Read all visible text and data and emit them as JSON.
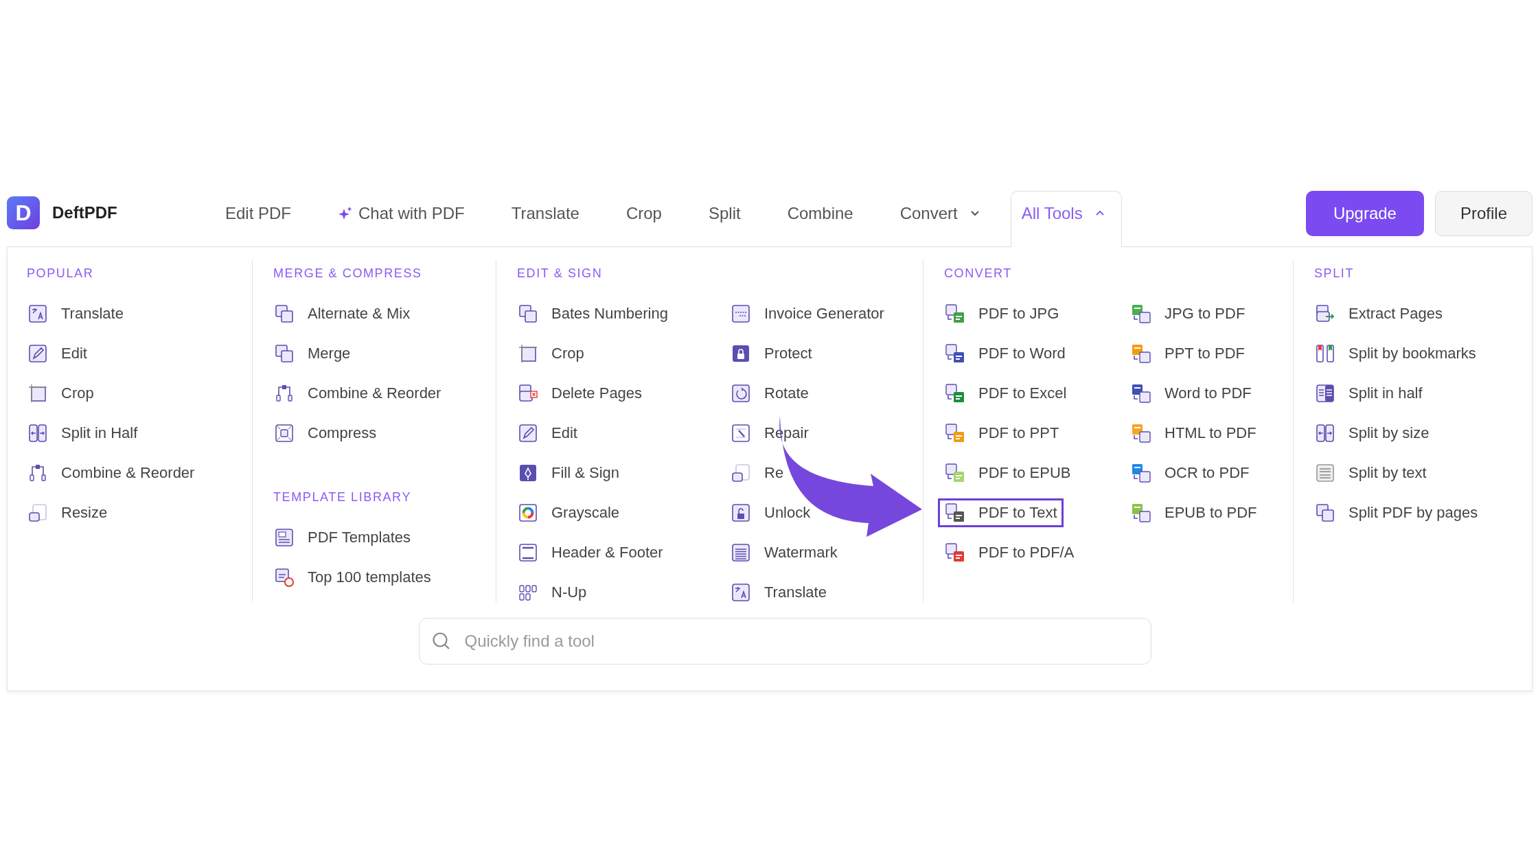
{
  "brand": {
    "mark": "D",
    "name": "DeftPDF"
  },
  "nav": [
    {
      "label": "Edit PDF",
      "kind": "link",
      "selected": false
    },
    {
      "label": "Chat with PDF",
      "kind": "ai",
      "selected": false
    },
    {
      "label": "Translate",
      "kind": "link",
      "selected": false
    },
    {
      "label": "Crop",
      "kind": "link",
      "selected": false
    },
    {
      "label": "Split",
      "kind": "link",
      "selected": false
    },
    {
      "label": "Combine",
      "kind": "link",
      "selected": false
    },
    {
      "label": "Convert",
      "kind": "dropdown",
      "selected": false,
      "expanded": false
    },
    {
      "label": "All Tools",
      "kind": "dropdown",
      "selected": true,
      "expanded": true
    }
  ],
  "actions": [
    {
      "label": "Upgrade",
      "kind": "primary"
    },
    {
      "label": "Profile",
      "kind": "secondary"
    }
  ],
  "menu": {
    "sections": [
      {
        "groups": [
          {
            "title": "POPULAR",
            "columns": [
              [
                {
                  "label": "Translate",
                  "highlighted": false
                },
                {
                  "label": "Edit",
                  "highlighted": false
                },
                {
                  "label": "Crop",
                  "highlighted": false
                },
                {
                  "label": "Split in Half",
                  "highlighted": false
                },
                {
                  "label": "Combine & Reorder",
                  "highlighted": false
                },
                {
                  "label": "Resize",
                  "highlighted": false
                }
              ]
            ]
          }
        ]
      },
      {
        "groups": [
          {
            "title": "MERGE & COMPRESS",
            "columns": [
              [
                {
                  "label": "Alternate & Mix",
                  "highlighted": false
                },
                {
                  "label": "Merge",
                  "highlighted": false
                },
                {
                  "label": "Combine & Reorder",
                  "highlighted": false
                },
                {
                  "label": "Compress",
                  "highlighted": false
                }
              ]
            ]
          },
          {
            "title": "TEMPLATE LIBRARY",
            "columns": [
              [
                {
                  "label": "PDF Templates",
                  "highlighted": false
                },
                {
                  "label": "Top 100 templates",
                  "highlighted": false
                }
              ]
            ]
          }
        ]
      },
      {
        "groups": [
          {
            "title": "EDIT & SIGN",
            "columns": [
              [
                {
                  "label": "Bates Numbering",
                  "highlighted": false
                },
                {
                  "label": "Crop",
                  "highlighted": false
                },
                {
                  "label": "Delete Pages",
                  "highlighted": false
                },
                {
                  "label": "Edit",
                  "highlighted": false
                },
                {
                  "label": "Fill & Sign",
                  "highlighted": false
                },
                {
                  "label": "Grayscale",
                  "highlighted": false
                },
                {
                  "label": "Header & Footer",
                  "highlighted": false
                },
                {
                  "label": "N-Up",
                  "highlighted": false
                }
              ],
              [
                {
                  "label": "Invoice Generator",
                  "highlighted": false
                },
                {
                  "label": "Protect",
                  "highlighted": false
                },
                {
                  "label": "Rotate",
                  "highlighted": false
                },
                {
                  "label": "Repair",
                  "highlighted": false
                },
                {
                  "label": "Re",
                  "highlighted": false
                },
                {
                  "label": "Unlock",
                  "highlighted": false
                },
                {
                  "label": "Watermark",
                  "highlighted": false
                },
                {
                  "label": "Translate",
                  "highlighted": false
                }
              ]
            ]
          }
        ]
      },
      {
        "groups": [
          {
            "title": "CONVERT",
            "columns": [
              [
                {
                  "label": "PDF to JPG",
                  "highlighted": false
                },
                {
                  "label": "PDF to Word",
                  "highlighted": false
                },
                {
                  "label": "PDF to Excel",
                  "highlighted": false
                },
                {
                  "label": "PDF to PPT",
                  "highlighted": false
                },
                {
                  "label": "PDF to EPUB",
                  "highlighted": false
                },
                {
                  "label": "PDF to Text",
                  "highlighted": true
                },
                {
                  "label": "PDF to PDF/A",
                  "highlighted": false
                }
              ],
              [
                {
                  "label": "JPG to PDF",
                  "highlighted": false
                },
                {
                  "label": "PPT to PDF",
                  "highlighted": false
                },
                {
                  "label": "Word to PDF",
                  "highlighted": false
                },
                {
                  "label": "HTML to PDF",
                  "highlighted": false
                },
                {
                  "label": "OCR to PDF",
                  "highlighted": false
                },
                {
                  "label": "EPUB to PDF",
                  "highlighted": false
                }
              ]
            ]
          }
        ]
      },
      {
        "groups": [
          {
            "title": "SPLIT",
            "columns": [
              [
                {
                  "label": "Extract Pages",
                  "highlighted": false
                },
                {
                  "label": "Split by bookmarks",
                  "highlighted": false
                },
                {
                  "label": "Split in half",
                  "highlighted": false
                },
                {
                  "label": "Split by size",
                  "highlighted": false
                },
                {
                  "label": "Split by text",
                  "highlighted": false
                },
                {
                  "label": "Split PDF by pages",
                  "highlighted": false
                }
              ]
            ]
          }
        ]
      }
    ]
  },
  "search": {
    "placeholder": "Quickly find a tool"
  },
  "annotation": {
    "kind": "arrow"
  }
}
